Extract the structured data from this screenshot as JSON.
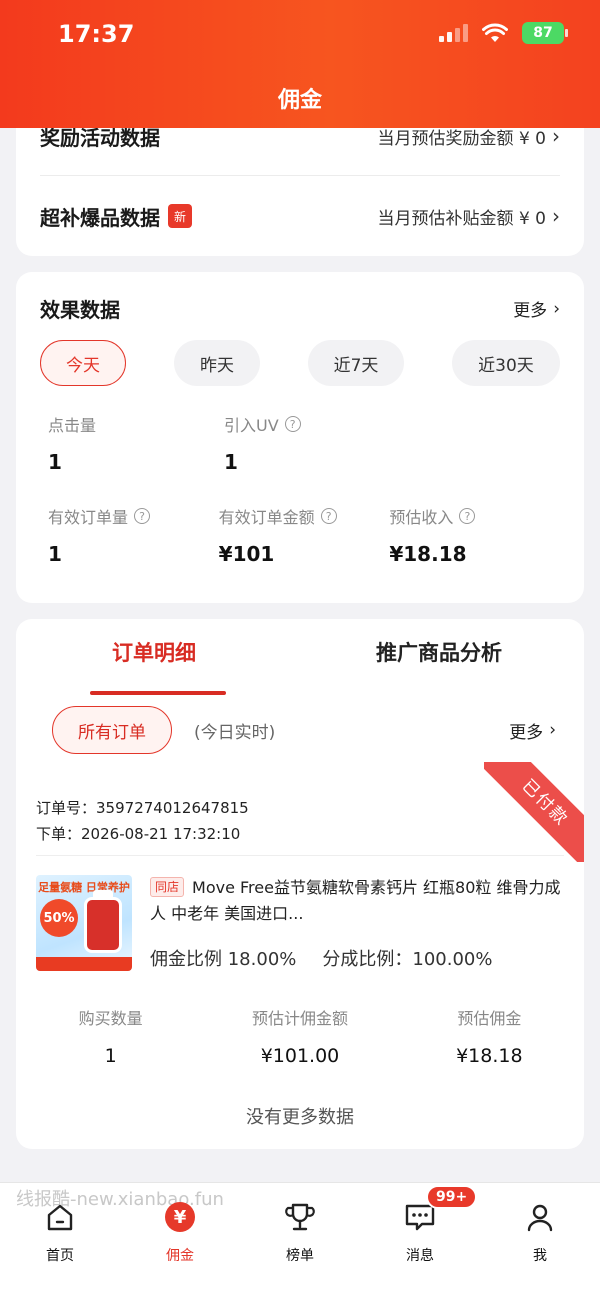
{
  "status_bar": {
    "time": "17:37",
    "battery": "87"
  },
  "header": {
    "title": "佣金"
  },
  "reward_card": {
    "reward_activity": {
      "label": "奖励活动数据",
      "value": "当月预估奖励金额 ¥ 0"
    },
    "subsidy": {
      "label": "超补爆品数据",
      "badge": "新",
      "value": "当月预估补贴金额 ¥ 0"
    }
  },
  "effect": {
    "title": "效果数据",
    "more": "更多",
    "ranges": [
      "今天",
      "昨天",
      "近7天",
      "近30天"
    ],
    "active_range": "今天",
    "metrics": {
      "clicks": {
        "label": "点击量",
        "value": "1"
      },
      "uv": {
        "label": "引入UV",
        "value": "1"
      },
      "valid_orders": {
        "label": "有效订单量",
        "value": "1"
      },
      "valid_amount": {
        "label": "有效订单金额",
        "value": "¥101"
      },
      "est_income": {
        "label": "预估收入",
        "value": "¥18.18"
      }
    }
  },
  "orders": {
    "tab_detail": "订单明细",
    "tab_analysis": "推广商品分析",
    "filter_all": "所有订单",
    "realtime": "(今日实时)",
    "more": "更多",
    "order": {
      "status": "已付款",
      "order_no_label": "订单号：",
      "order_no": "3597274012647815",
      "placed_label": "下单：",
      "placed_time": "2026-08-21 17:32:10",
      "product": {
        "shop_tag": "同店",
        "name": "Move Free益节氨糖软骨素钙片 红瓶80粒 维骨力成人 中老年 美国进口...",
        "image_headline": "足量氨糖 日常养护",
        "image_badge": "50%",
        "commission_rate_label": "佣金比例",
        "commission_rate": "18.00%",
        "share_rate_label": "分成比例：",
        "share_rate": "100.00%"
      },
      "stats": {
        "qty_label": "购买数量",
        "qty": "1",
        "est_amount_label": "预估计佣金额",
        "est_amount": "¥101.00",
        "est_commission_label": "预估佣金",
        "est_commission": "¥18.18"
      }
    },
    "no_more": "没有更多数据"
  },
  "watermark": "线报酷-new.xianbao.fun",
  "bottom_nav": {
    "items": [
      {
        "label": "首页",
        "icon": "home-icon"
      },
      {
        "label": "佣金",
        "icon": "yen-icon",
        "active": true
      },
      {
        "label": "榜单",
        "icon": "trophy-icon"
      },
      {
        "label": "消息",
        "icon": "message-icon",
        "badge": "99+"
      },
      {
        "label": "我",
        "icon": "user-icon"
      }
    ]
  },
  "colors": {
    "brand": "#f4421f",
    "accent": "#e3362a"
  }
}
